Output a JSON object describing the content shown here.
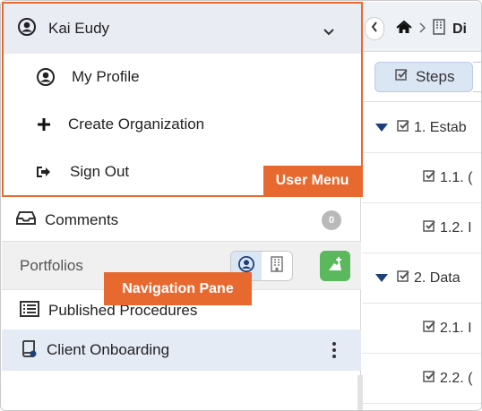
{
  "user_menu": {
    "user_name": "Kai Eudy",
    "items": [
      {
        "label": "My Profile",
        "icon": "user-circle-icon"
      },
      {
        "label": "Create Organization",
        "icon": "plus-icon"
      },
      {
        "label": "Sign Out",
        "icon": "sign-out-icon"
      }
    ]
  },
  "nav": {
    "comments_label": "Comments",
    "comments_count": "0",
    "portfolios_label": "Portfolios",
    "rows": [
      {
        "label": "Published Procedures",
        "icon": "list-icon"
      },
      {
        "label": "Client Onboarding",
        "icon": "book-icon"
      }
    ]
  },
  "callouts": {
    "user_menu": "User Menu",
    "navigation_pane": "Navigation Pane"
  },
  "content": {
    "breadcrumb_current": "Di",
    "tab_steps": "Steps",
    "steps": [
      {
        "text": "1. Estab",
        "level": 1
      },
      {
        "text": "1.1. (",
        "level": 2
      },
      {
        "text": "1.2. I",
        "level": 2
      },
      {
        "text": "2. Data",
        "level": 1
      },
      {
        "text": "2.1. I",
        "level": 2
      },
      {
        "text": "2.2. (",
        "level": 2
      }
    ]
  },
  "colors": {
    "accent_callout": "#e8692f",
    "selected_row": "#e4ebf5",
    "add_button": "#5cb85c",
    "tree_triangle": "#1d3f7a"
  }
}
